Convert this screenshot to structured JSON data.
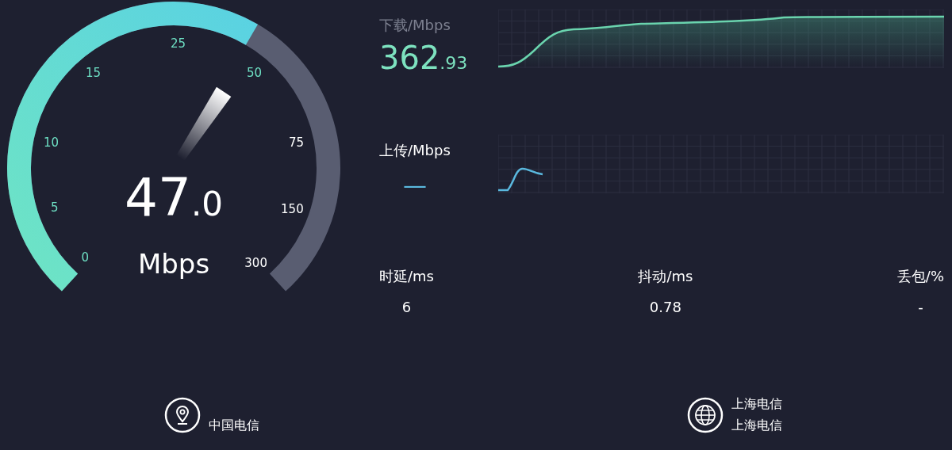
{
  "gauge": {
    "value_integer": "47",
    "value_decimal": ".0",
    "unit": "Mbps",
    "ticks": [
      {
        "label": "0",
        "reached": true
      },
      {
        "label": "5",
        "reached": true
      },
      {
        "label": "10",
        "reached": true
      },
      {
        "label": "15",
        "reached": true
      },
      {
        "label": "25",
        "reached": true
      },
      {
        "label": "50",
        "reached": true
      },
      {
        "label": "75",
        "reached": false
      },
      {
        "label": "150",
        "reached": false
      },
      {
        "label": "300",
        "reached": false
      }
    ]
  },
  "download": {
    "label": "下载/Mbps",
    "active": false,
    "value_integer": "362",
    "value_decimal": ".93"
  },
  "upload": {
    "label": "上传/Mbps",
    "active": true,
    "value": "—"
  },
  "metrics": [
    {
      "label": "时延/ms",
      "value": "6"
    },
    {
      "label": "抖动/ms",
      "value": "0.78"
    },
    {
      "label": "丢包/%",
      "value": "-"
    }
  ],
  "footer": {
    "client": {
      "isp": "中国电信"
    },
    "server": {
      "name": "上海电信",
      "isp": "上海电信"
    }
  }
}
